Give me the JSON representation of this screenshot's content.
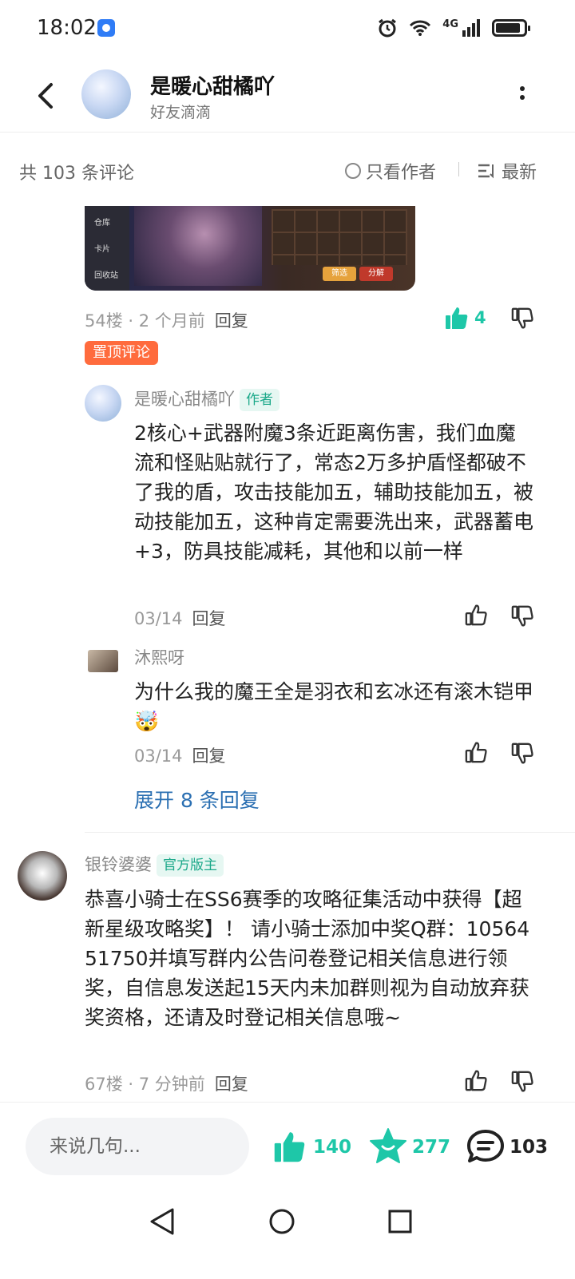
{
  "status_bar": {
    "time": "18:02",
    "network": "4G"
  },
  "header": {
    "title": "是暖心甜橘吖",
    "subtitle": "好友滴滴"
  },
  "sort_bar": {
    "count": "共 103 条评论",
    "only_author": "只看作者",
    "sort": "最新"
  },
  "game_image": {
    "side_items": [
      "仓库",
      "卡片",
      "回收站"
    ],
    "buttons": [
      "筛选",
      "分解"
    ]
  },
  "comment_54": {
    "floor": "54楼",
    "time": "2 个月前",
    "reply": "回复",
    "likes": "4"
  },
  "pinned_tag": "置顶评论",
  "replies": [
    {
      "name": "是暖心甜橘吖",
      "tag": "作者",
      "text": "2核心+武器附魔3条近距离伤害，我们血魔流和怪贴贴就行了，常态2万多护盾怪都破不了我的盾，攻击技能加五，辅助技能加五，被动技能加五，这种肯定需要洗出来，武器蓄电+3，防具技能减耗，其他和以前一样",
      "date": "03/14",
      "reply": "回复"
    },
    {
      "name": "沐熙呀",
      "text": "为什么我的魔王全是羽衣和玄冰还有滚木铠甲",
      "emoji": "🤯",
      "date": "03/14",
      "reply": "回复"
    }
  ],
  "expand": "展开 8 条回复",
  "comment_67": {
    "name": "银铃婆婆",
    "tag": "官方版主",
    "text": "恭喜小骑士在SS6赛季的攻略征集活动中获得【超新星级攻略奖】！ 请小骑士添加中奖Q群：1056451750并填写群内公告问卷登记相关信息进行领奖，自信息发送起15天内未加群则视为自动放弃获奖资格，还请及时登记相关信息哦~",
    "floor": "67楼",
    "time": "7 分钟前",
    "reply": "回复"
  },
  "bottom_bar": {
    "placeholder": "来说几句...",
    "likes": "140",
    "favorites": "277",
    "comments": "103"
  },
  "colors": {
    "accent": "#1ec7a8",
    "pin": "#ff6b3d",
    "link": "#2a6fb2"
  }
}
